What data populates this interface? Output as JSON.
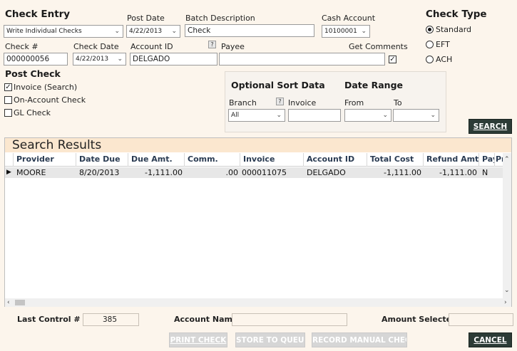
{
  "check_entry": {
    "title": "Check Entry",
    "mode_value": "Write Individual Checks",
    "post_date_label": "Post Date",
    "post_date_value": "4/22/2013",
    "batch_desc_label": "Batch Description",
    "batch_desc_value": "Check",
    "cash_account_label": "Cash Account",
    "cash_account_value": "10100001",
    "check_num_label": "Check #",
    "check_num_value": "000000056",
    "check_date_label": "Check Date",
    "check_date_value": "4/22/2013",
    "account_id_label": "Account ID",
    "account_id_value": "DELGADO",
    "payee_label": "Payee",
    "payee_value": "",
    "get_comments_label": "Get Comments",
    "help_glyph": "?"
  },
  "check_type": {
    "title": "Check Type",
    "options": [
      "Standard",
      "EFT",
      "ACH"
    ],
    "selected": "Standard"
  },
  "post_check": {
    "title": "Post Check",
    "options": [
      "Invoice (Search)",
      "On-Account Check",
      "GL Check"
    ]
  },
  "sort": {
    "title": "Optional Sort Data",
    "branch_label": "Branch",
    "branch_value": "All",
    "invoice_label": "Invoice",
    "invoice_value": "",
    "date_range_title": "Date Range",
    "from_label": "From",
    "to_label": "To"
  },
  "search_button": "SEARCH",
  "results": {
    "title": "Search Results",
    "columns": [
      "Provider",
      "Date Due",
      "Due Amt.",
      "Comm.",
      "Invoice",
      "Account ID",
      "Total Cost",
      "Refund Amt",
      "Pay",
      "Pr"
    ],
    "rows": [
      [
        "MOORE",
        "8/20/2013",
        "-1,111.00",
        ".00",
        "000011075",
        "DELGADO",
        "-1,111.00",
        "-1,111.00",
        "N",
        ""
      ]
    ]
  },
  "footer": {
    "last_control_label": "Last Control #",
    "last_control_value": "385",
    "account_name_label": "Account Name",
    "account_name_value": "",
    "amount_selected_label": "Amount Selected",
    "amount_selected_value": "",
    "print_check": "PRINT CHECK",
    "store_to_queue": "STORE TO QUEUE",
    "record_manual_check": "RECORD MANUAL CHECK",
    "cancel": "CANCEL"
  },
  "colors": {
    "background": "#fcf5ec",
    "results_header": "#fbe7cf",
    "dark_button": "#2c3b36",
    "disabled_button": "#d6d6d6",
    "column_header_text": "#2a3b52"
  }
}
